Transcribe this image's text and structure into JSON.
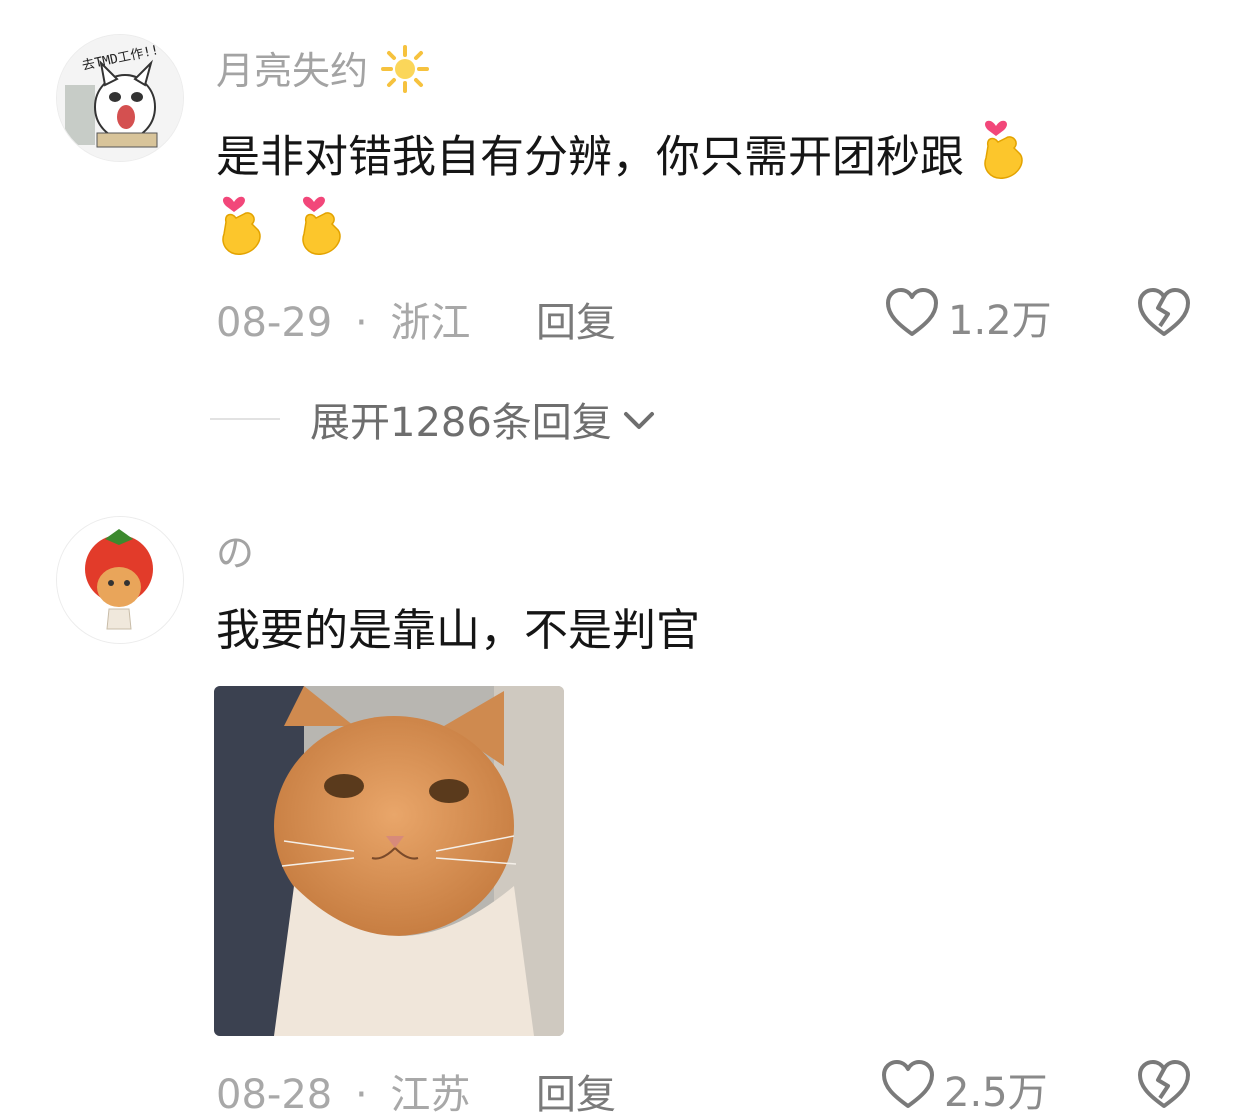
{
  "comments": [
    {
      "username": "月亮失约",
      "username_emoji": "sun-icon",
      "text": "是非对错我自有分辨，你只需开团秒跟",
      "text_emojis": [
        "finger-heart-icon",
        "finger-heart-icon",
        "finger-heart-icon"
      ],
      "avatar_caption": "去TMD工作!!",
      "date": "08-29",
      "separator": "·",
      "location": "浙江",
      "reply_label": "回复",
      "like_count": "1.2万",
      "expand_replies_label": "展开1286条回复"
    },
    {
      "username": "の",
      "text": "我要的是靠山，不是判官",
      "has_image": true,
      "date": "08-28",
      "separator": "·",
      "location": "江苏",
      "reply_label": "回复",
      "like_count": "2.5万"
    }
  ],
  "colors": {
    "username": "#a3a3a3",
    "text": "#151515",
    "meta": "#a8a8a8",
    "icon": "#7a7a7a"
  }
}
